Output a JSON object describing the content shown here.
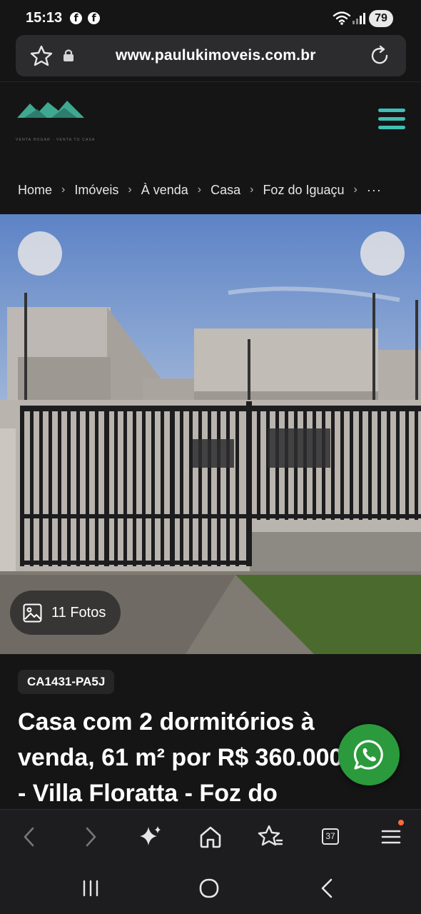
{
  "status_bar": {
    "time": "15:13",
    "notification_icons": [
      "facebook-icon",
      "facebook-icon"
    ],
    "battery": "79"
  },
  "address_bar": {
    "url": "www.paulukimoveis.com.br"
  },
  "header": {
    "logo_tagline": "VENTA HOGAR · VENTA TU CASA"
  },
  "breadcrumb": {
    "items": [
      "Home",
      "Imóveis",
      "À venda",
      "Casa",
      "Foz do Iguaçu"
    ],
    "separator": "›",
    "more": "···"
  },
  "gallery": {
    "photo_count_label": "11 Fotos"
  },
  "listing": {
    "reference": "CA1431-PA5J",
    "title_lines": [
      "Casa com 2 dormitórios à",
      "venda, 61 m² por R$ 360.000",
      "- Villa Floratta - Foz do"
    ]
  },
  "colors": {
    "accent": "#3fbfb5",
    "whatsapp": "#2b9a3c",
    "background": "#151515"
  }
}
